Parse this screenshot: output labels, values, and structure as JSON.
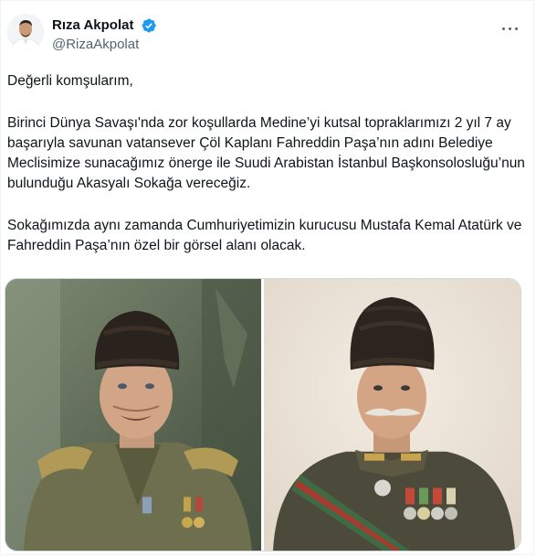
{
  "author": {
    "display_name": "Rıza Akpolat",
    "handle": "@RizaAkpolat",
    "avatar_icon": "profile-photo",
    "verified_icon": "verified-badge-icon",
    "verified_color": "#1d9bf0"
  },
  "menu": {
    "more_icon": "more-options-icon"
  },
  "tweet": {
    "paragraphs": [
      "Değerli komşularım,",
      "Birinci Dünya Savaşı'nda zor koşullarda Medine’yi kutsal topraklarımızı 2 yıl 7 ay başarıyla savunan vatansever Çöl Kaplanı Fahreddin Paşa’nın adını Belediye Meclisimize sunacağımız önerge ile Suudi Arabistan İstanbul Başkonsolosluğu’nun bulunduğu Akasyalı Sokağa vereceğiz.",
      "Sokağımızda aynı zamanda Cumhuriyetimizin kurucusu Mustafa Kemal Atatürk ve Fahreddin Paşa’nın özel bir görsel alanı olacak."
    ]
  },
  "media": {
    "images": [
      {
        "icon": "portrait-photo-left"
      },
      {
        "icon": "portrait-photo-right"
      }
    ]
  },
  "colors": {
    "text": "#0f1419",
    "secondary": "#536471",
    "border": "#cfd9de"
  }
}
